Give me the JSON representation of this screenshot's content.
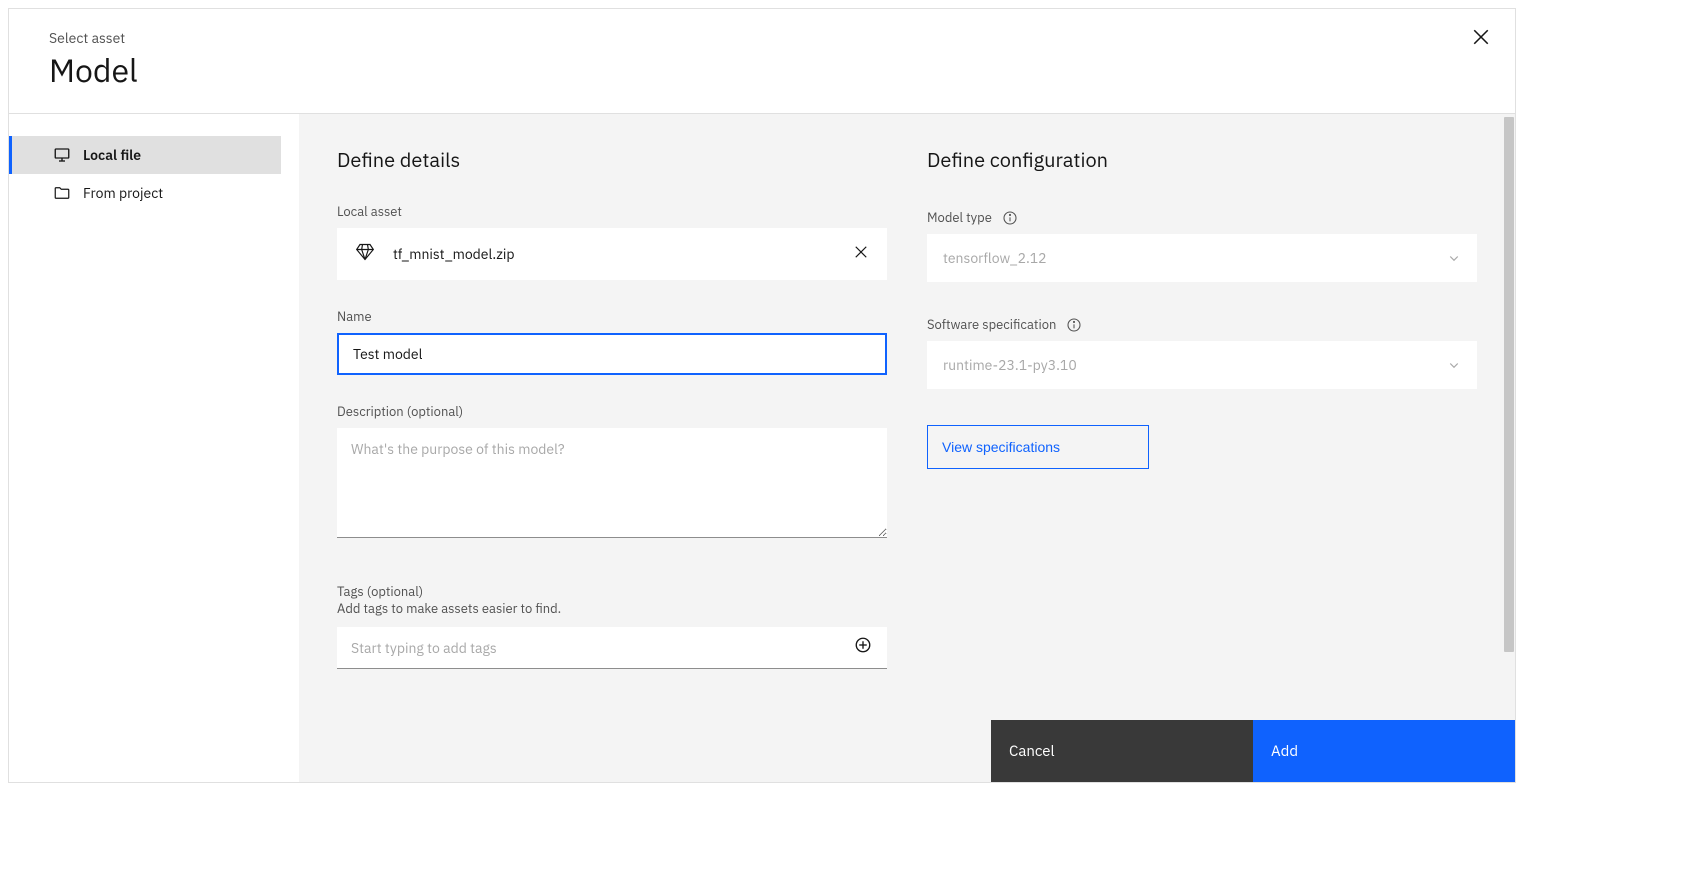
{
  "header": {
    "subtitle": "Select asset",
    "title": "Model"
  },
  "sidebar": {
    "items": [
      {
        "label": "Local file"
      },
      {
        "label": "From project"
      }
    ]
  },
  "details": {
    "title": "Define details",
    "local_asset_label": "Local asset",
    "file_name": "tf_mnist_model.zip",
    "name_label": "Name",
    "name_value": "Test model",
    "description_label": "Description (optional)",
    "description_placeholder": "What's the purpose of this model?",
    "tags_label": "Tags (optional)",
    "tags_helper": "Add tags to make assets easier to find.",
    "tags_placeholder": "Start typing to add tags"
  },
  "config": {
    "title": "Define configuration",
    "model_type_label": "Model type",
    "model_type_value": "tensorflow_2.12",
    "software_spec_label": "Software specification",
    "software_spec_value": "runtime-23.1-py3.10",
    "view_specs_label": "View specifications"
  },
  "footer": {
    "cancel": "Cancel",
    "add": "Add"
  }
}
